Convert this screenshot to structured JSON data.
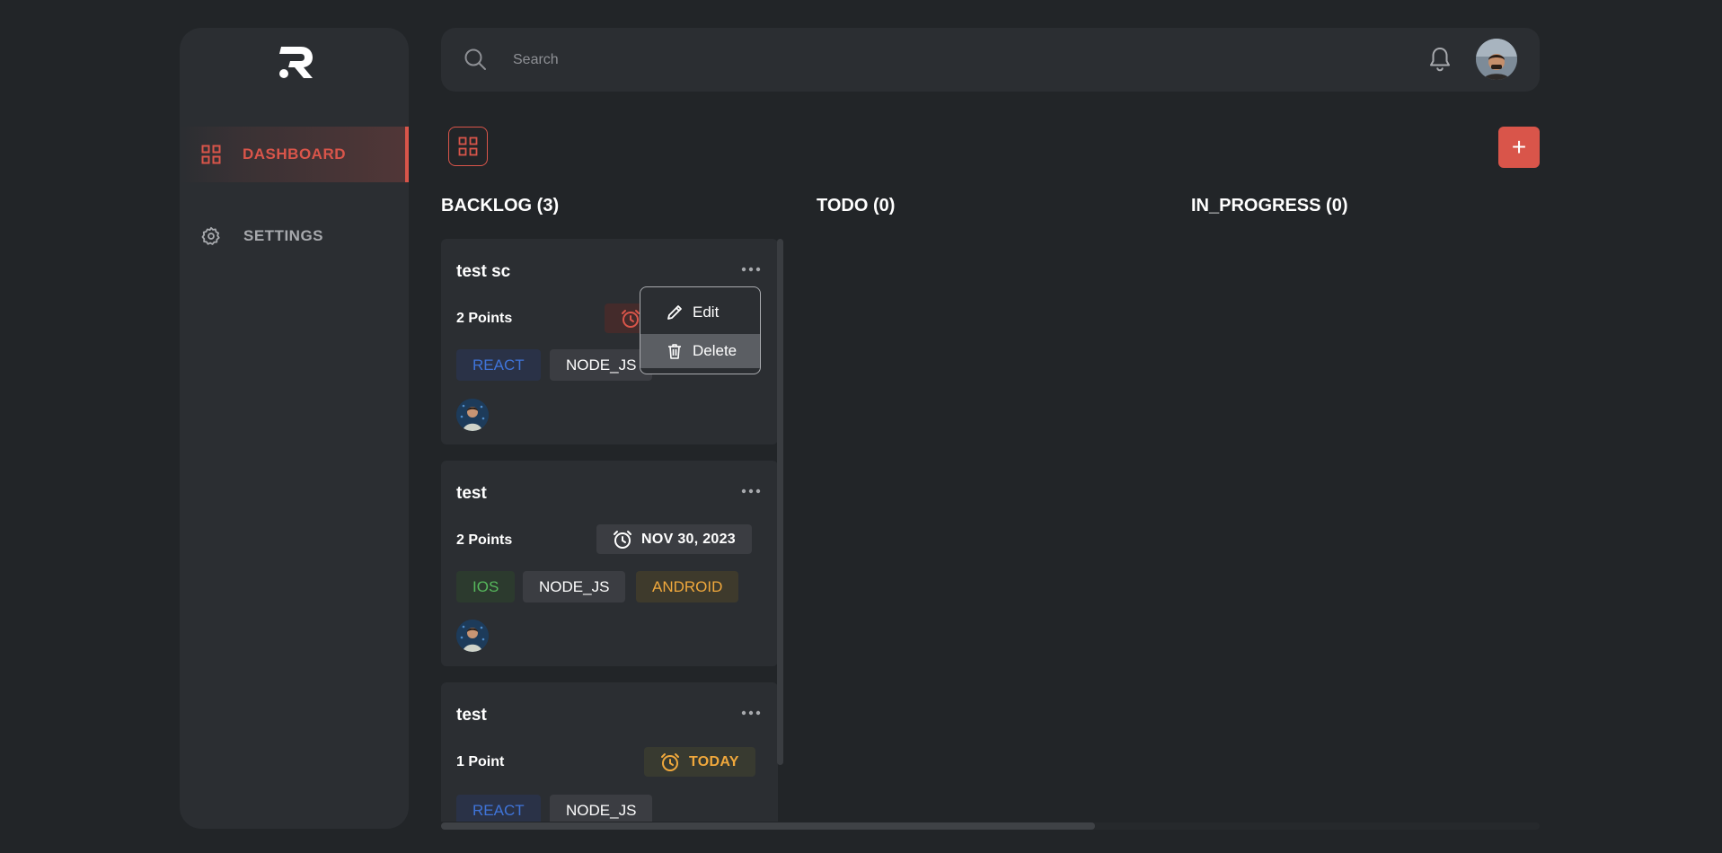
{
  "brand": {
    "logo_letter": "R",
    "accent": "#d9554a"
  },
  "sidebar": {
    "items": [
      {
        "label": "DASHBOARD",
        "icon": "grid-icon",
        "active": true
      },
      {
        "label": "SETTINGS",
        "icon": "gear-icon",
        "active": false
      }
    ]
  },
  "search": {
    "placeholder": "Search"
  },
  "header": {
    "bell_icon": "bell-icon"
  },
  "toolbar": {
    "add_label": "+"
  },
  "columns": [
    {
      "title": "BACKLOG (3)"
    },
    {
      "title": "TODO (0)"
    },
    {
      "title": "IN_PROGRESS (0)"
    }
  ],
  "cards": [
    {
      "title": "test sc",
      "points": "2 Points",
      "due": "",
      "tags": [
        "REACT",
        "NODE_JS"
      ]
    },
    {
      "title": "test",
      "points": "2 Points",
      "due": "NOV 30, 2023",
      "tags": [
        "IOS",
        "NODE_JS",
        "ANDROID"
      ]
    },
    {
      "title": "test",
      "points": "1 Point",
      "due": "TODAY",
      "tags": [
        "REACT",
        "NODE_JS"
      ]
    }
  ],
  "context_menu": {
    "edit": "Edit",
    "delete": "Delete"
  }
}
